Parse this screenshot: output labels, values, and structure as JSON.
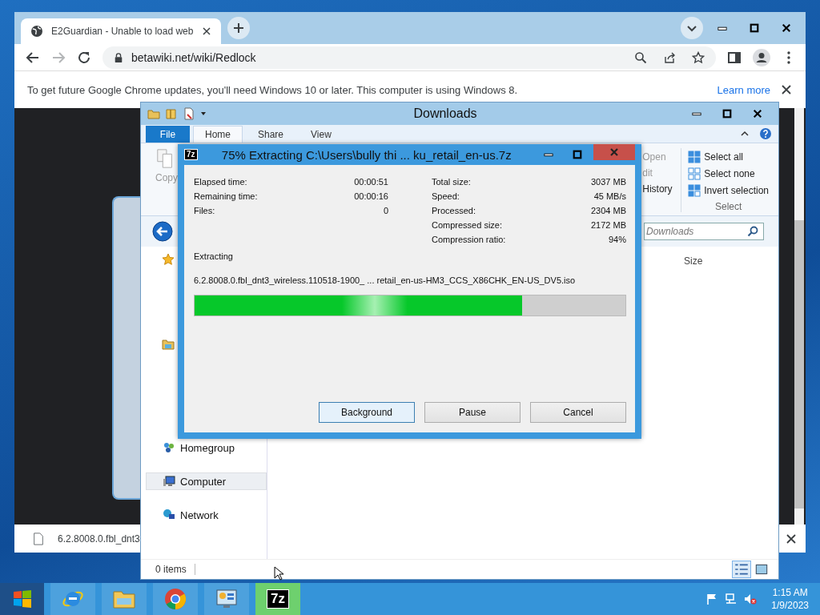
{
  "browser": {
    "tab": {
      "title": "E2Guardian - Unable to load web",
      "selected": true
    },
    "address": "betawiki.net/wiki/Redlock",
    "infobar": {
      "message": "To get future Google Chrome updates, you'll need Windows 10 or later. This computer is using Windows 8.",
      "link": "Learn more"
    },
    "download": {
      "filename": "6.2.8008.0.fbl_dnt3"
    }
  },
  "explorer": {
    "title": "Downloads",
    "ribbon_tabs": [
      {
        "label": "File",
        "kind": "file",
        "selected": false
      },
      {
        "label": "Home",
        "kind": "tab",
        "selected": true
      },
      {
        "label": "Share",
        "kind": "tab",
        "selected": false
      },
      {
        "label": "View",
        "kind": "tab",
        "selected": false
      }
    ],
    "copy": {
      "label": "Copy",
      "disabled": true
    },
    "open_group": [
      {
        "label": "Open",
        "disabled": true
      },
      {
        "label": "dit",
        "disabled": true
      },
      {
        "label": "History",
        "disabled": false
      }
    ],
    "select_group": {
      "items": [
        "Select all",
        "Select none",
        "Invert selection"
      ],
      "label": "Select"
    },
    "search_placeholder": "Downloads",
    "nav": [
      {
        "label": "Homegroup",
        "kind": "homegroup",
        "selected": false
      },
      {
        "label": "Computer",
        "kind": "computer",
        "selected": true
      },
      {
        "label": "Network",
        "kind": "network",
        "selected": false
      }
    ],
    "column": "Size",
    "status": "0 items"
  },
  "dialog": {
    "icon_text": "7z",
    "title": "75% Extracting C:\\Users\\bully thi ... ku_retail_en-us.7z",
    "stats_left": [
      {
        "label": "Elapsed time:",
        "value": "00:00:51"
      },
      {
        "label": "Remaining time:",
        "value": "00:00:16"
      },
      {
        "label": "Files:",
        "value": "0"
      }
    ],
    "stats_right": [
      {
        "label": "Total size:",
        "value": "3037 MB"
      },
      {
        "label": "Speed:",
        "value": "45 MB/s"
      },
      {
        "label": "Processed:",
        "value": "2304 MB"
      },
      {
        "label": "Compressed size:",
        "value": "2172 MB"
      },
      {
        "label": "Compression ratio:",
        "value": "94%"
      }
    ],
    "operation": "Extracting",
    "file": "6.2.8008.0.fbl_dnt3_wireless.110518-1900_ ... retail_en-us-HM3_CCS_X86CHK_EN-US_DV5.iso",
    "progress": {
      "level": 0.76
    },
    "buttons": [
      {
        "label": "Background",
        "focused": true
      },
      {
        "label": "Pause",
        "focused": false
      },
      {
        "label": "Cancel",
        "focused": false
      }
    ]
  },
  "taskbar": {
    "apps": [
      {
        "kind": "ie",
        "selected": false
      },
      {
        "kind": "explorer",
        "selected": false
      },
      {
        "kind": "chrome",
        "selected": false
      },
      {
        "kind": "control-panel",
        "selected": false
      },
      {
        "kind": "sevenzip",
        "icon_text": "7z",
        "selected": true
      }
    ],
    "time": "1:15 AM",
    "date": "1/9/2023"
  }
}
